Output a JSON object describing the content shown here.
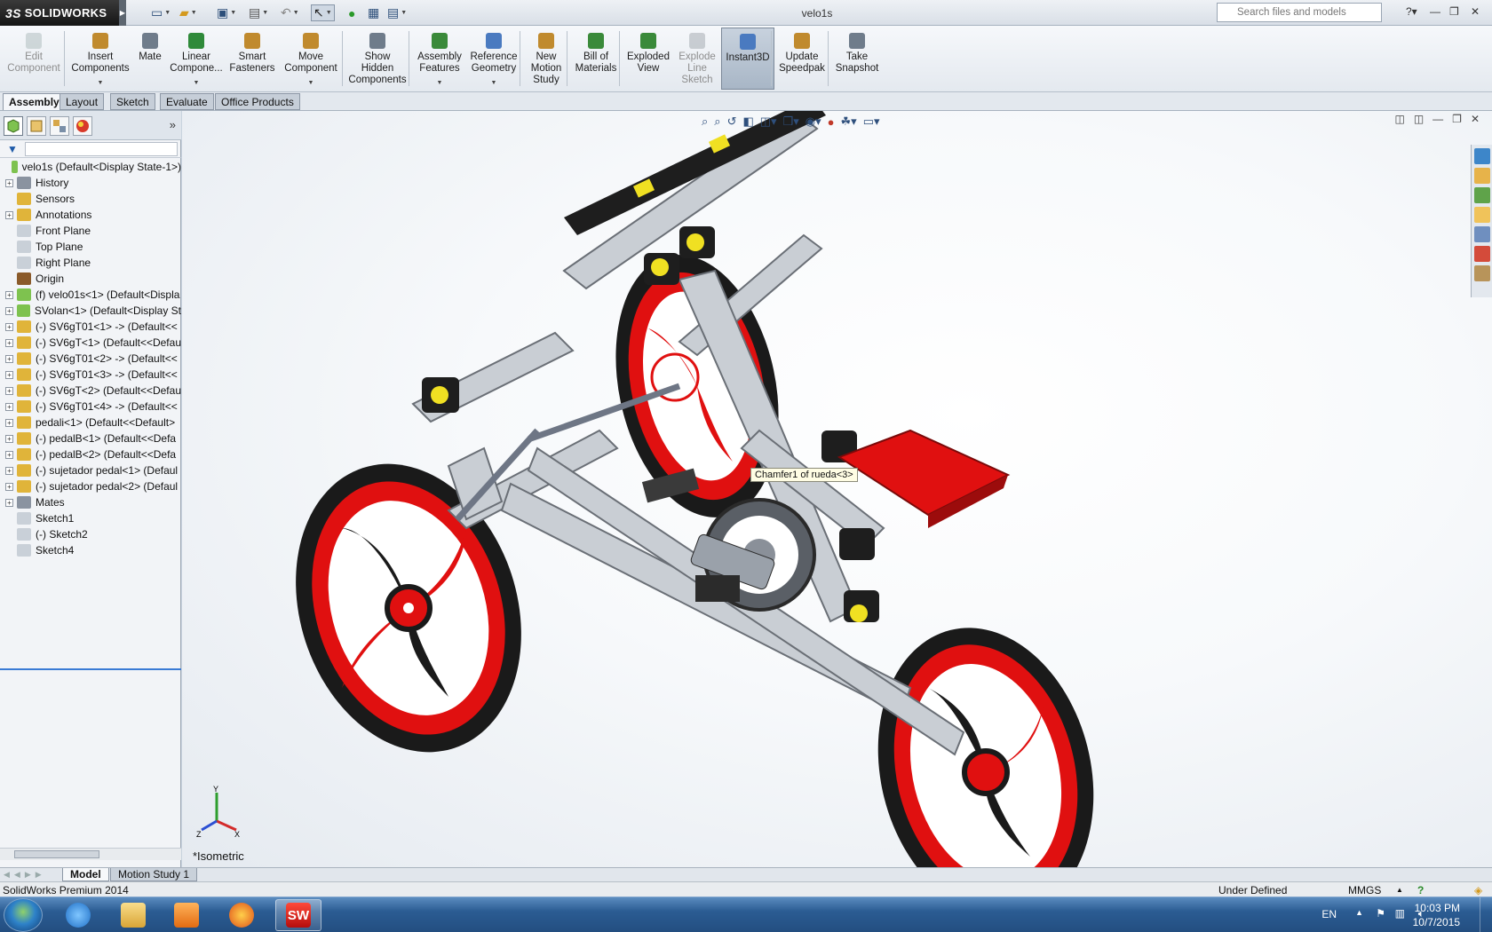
{
  "app": {
    "logo_text": "SOLIDWORKS",
    "logo_ds": "3S",
    "document_title": "velo1s",
    "search_placeholder": "Search files and models"
  },
  "command_manager": {
    "buttons": [
      {
        "label": "Edit\nComponent",
        "icon": "edit-component-icon",
        "disabled": true
      },
      {
        "label": "Insert\nComponents",
        "icon": "insert-components-icon"
      },
      {
        "label": "Mate",
        "icon": "mate-icon"
      },
      {
        "label": "Linear\nCompone...",
        "icon": "linear-pattern-icon"
      },
      {
        "label": "Smart\nFasteners",
        "icon": "smart-fasteners-icon"
      },
      {
        "label": "Move\nComponent",
        "icon": "move-component-icon"
      },
      {
        "label": "Show\nHidden\nComponents",
        "icon": "show-hidden-icon"
      },
      {
        "label": "Assembly\nFeatures",
        "icon": "assembly-features-icon"
      },
      {
        "label": "Reference\nGeometry",
        "icon": "reference-geometry-icon"
      },
      {
        "label": "New\nMotion\nStudy",
        "icon": "motion-study-icon"
      },
      {
        "label": "Bill of\nMaterials",
        "icon": "bill-of-materials-icon"
      },
      {
        "label": "Exploded\nView",
        "icon": "exploded-view-icon"
      },
      {
        "label": "Explode\nLine\nSketch",
        "icon": "explode-line-icon",
        "disabled": true
      },
      {
        "label": "Instant3D",
        "icon": "instant3d-icon",
        "active": true
      },
      {
        "label": "Update\nSpeedpak",
        "icon": "speedpak-icon"
      },
      {
        "label": "Take\nSnapshot",
        "icon": "snapshot-icon"
      }
    ]
  },
  "tabs": [
    "Assembly",
    "Layout",
    "Sketch",
    "Evaluate",
    "Office Products"
  ],
  "active_tab": "Assembly",
  "feature_tree": {
    "root": "velo1s  (Default<Display State-1>)",
    "items": [
      {
        "label": "History",
        "expand": true,
        "icon": "history-icon"
      },
      {
        "label": "Sensors",
        "expand": false,
        "icon": "sensor-icon"
      },
      {
        "label": "Annotations",
        "expand": true,
        "icon": "annotations-icon"
      },
      {
        "label": "Front Plane",
        "expand": false,
        "icon": "plane-icon"
      },
      {
        "label": "Top Plane",
        "expand": false,
        "icon": "plane-icon"
      },
      {
        "label": "Right Plane",
        "expand": false,
        "icon": "plane-icon"
      },
      {
        "label": "Origin",
        "expand": false,
        "icon": "origin-icon"
      },
      {
        "label": "(f) velo01s<1> (Default<Displa",
        "expand": true,
        "icon": "subassembly-icon"
      },
      {
        "label": "SVolan<1> (Default<Display St",
        "expand": true,
        "icon": "subassembly-icon"
      },
      {
        "label": "(-) SV6gT01<1> -> (Default<<",
        "expand": true,
        "icon": "part-icon"
      },
      {
        "label": "(-) SV6gT<1> (Default<<Defau",
        "expand": true,
        "icon": "part-icon"
      },
      {
        "label": "(-) SV6gT01<2> -> (Default<<",
        "expand": true,
        "icon": "part-icon"
      },
      {
        "label": "(-) SV6gT01<3> -> (Default<<",
        "expand": true,
        "icon": "part-icon"
      },
      {
        "label": "(-) SV6gT<2> (Default<<Defau",
        "expand": true,
        "icon": "part-icon"
      },
      {
        "label": "(-) SV6gT01<4> -> (Default<<",
        "expand": true,
        "icon": "part-icon"
      },
      {
        "label": "pedali<1> (Default<<Default>",
        "expand": true,
        "icon": "part-icon"
      },
      {
        "label": "(-) pedalB<1> (Default<<Defa",
        "expand": true,
        "icon": "part-icon"
      },
      {
        "label": "(-) pedalB<2> (Default<<Defa",
        "expand": true,
        "icon": "part-icon"
      },
      {
        "label": "(-) sujetador pedal<1> (Defaul",
        "expand": true,
        "icon": "part-icon"
      },
      {
        "label": "(-) sujetador pedal<2> (Defaul",
        "expand": true,
        "icon": "part-icon"
      },
      {
        "label": "Mates",
        "expand": true,
        "icon": "mates-icon"
      },
      {
        "label": "Sketch1",
        "expand": false,
        "icon": "sketch-icon"
      },
      {
        "label": "(-) Sketch2",
        "expand": false,
        "icon": "sketch-icon"
      },
      {
        "label": "Sketch4",
        "expand": false,
        "icon": "sketch-icon"
      }
    ]
  },
  "viewport": {
    "tooltip": "Chamfer1 of rueda<3>",
    "view_name": "*Isometric",
    "triad": {
      "x": "X",
      "y": "Y",
      "z": "Z"
    }
  },
  "bottom_tabs": [
    "Model",
    "Motion Study 1"
  ],
  "status": {
    "product": "SolidWorks Premium 2014",
    "state": "Under Defined",
    "units": "MMGS"
  },
  "taskbar": {
    "lang": "EN",
    "time": "10:03 PM",
    "date": "10/7/2015"
  },
  "colors": {
    "wheel_red": "#e01010",
    "frame_gray": "#b9bec5",
    "accent_blue": "#3a7bd5"
  }
}
